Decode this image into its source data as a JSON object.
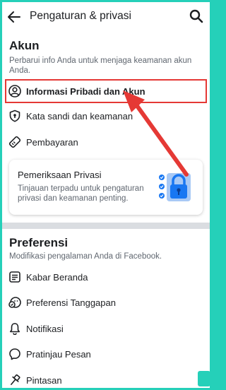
{
  "header": {
    "title": "Pengaturan & privasi"
  },
  "akun": {
    "title": "Akun",
    "description": "Perbarui info Anda untuk menjaga keamanan akun Anda.",
    "items": [
      {
        "label": "Informasi Pribadi dan Akun",
        "icon": "person-circle-icon"
      },
      {
        "label": "Kata sandi dan keamanan",
        "icon": "shield-icon"
      },
      {
        "label": "Pembayaran",
        "icon": "tag-icon"
      }
    ]
  },
  "privacy_card": {
    "title": "Pemeriksaan Privasi",
    "description": "Tinjauan terpadu untuk pengaturan privasi dan keamanan penting.",
    "icon": "privacy-lock-checklist-icon"
  },
  "preferensi": {
    "title": "Preferensi",
    "description": "Modifikasi pengalaman Anda di Facebook.",
    "items": [
      {
        "label": "Kabar Beranda",
        "icon": "news-feed-icon"
      },
      {
        "label": "Preferensi Tanggapan",
        "icon": "reaction-preferences-icon"
      },
      {
        "label": "Notifikasi",
        "icon": "bell-icon"
      },
      {
        "label": "Pratinjau Pesan",
        "icon": "message-bubble-icon"
      },
      {
        "label": "Pintasan",
        "icon": "pin-icon"
      }
    ]
  },
  "colors": {
    "highlight": "#e53935",
    "arrow": "#e53935",
    "frame": "#25d0b9",
    "card_icon_blue": "#1877f2"
  }
}
